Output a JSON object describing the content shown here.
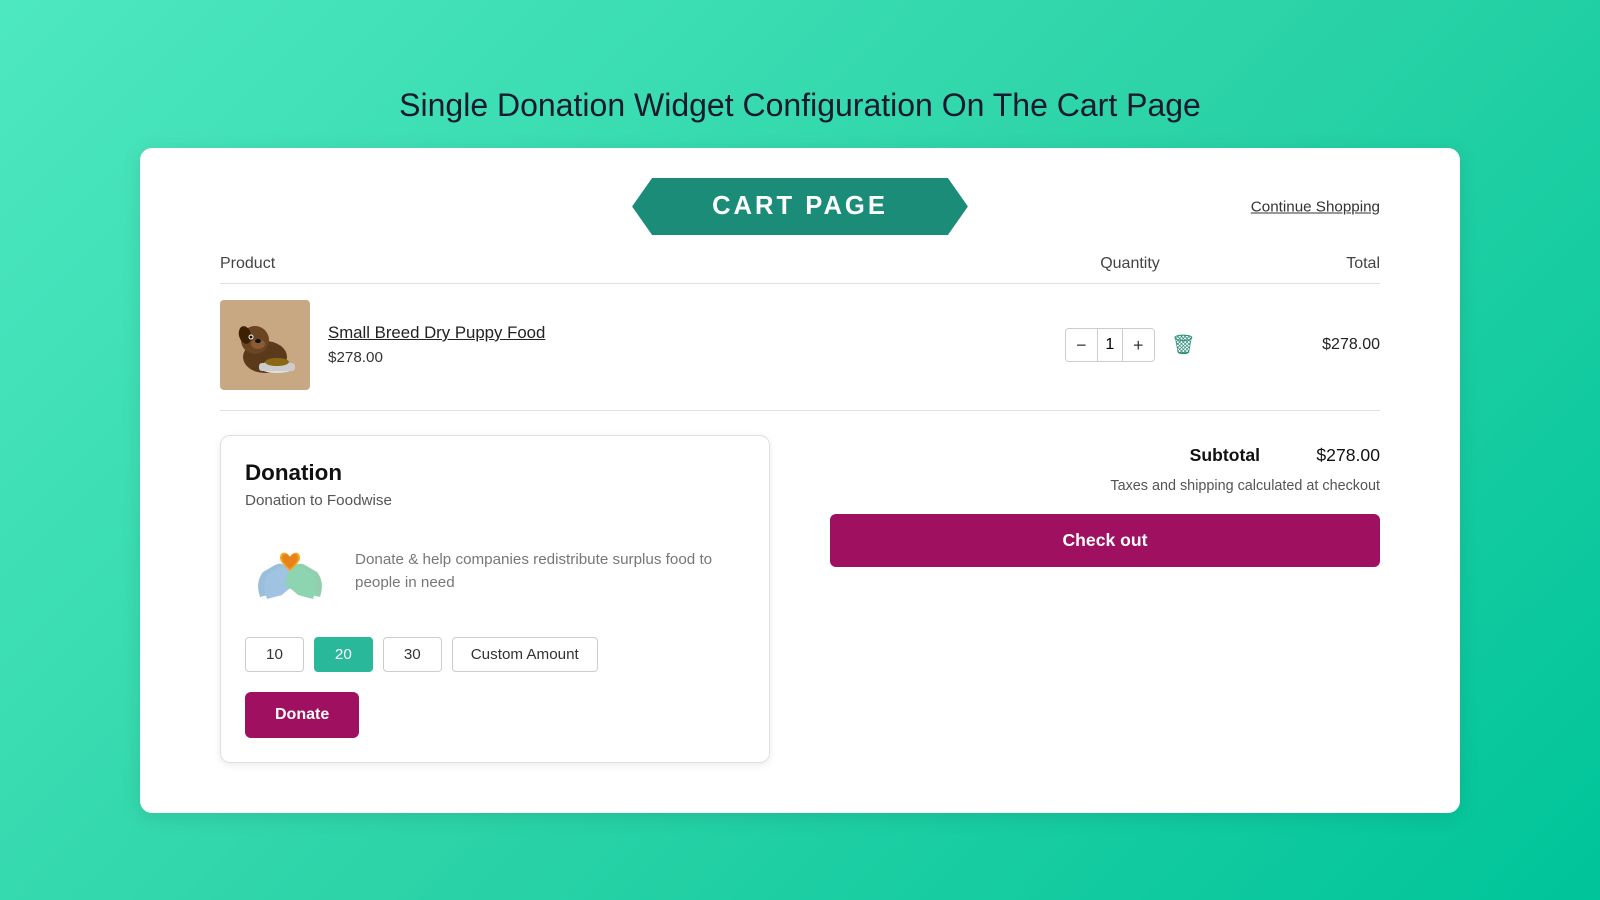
{
  "page": {
    "title": "Single Donation Widget Configuration On The Cart Page"
  },
  "header": {
    "cart_label": "CART PAGE",
    "continue_shopping": "Continue Shopping"
  },
  "table": {
    "col_product": "Product",
    "col_quantity": "Quantity",
    "col_total": "Total"
  },
  "product": {
    "name": "Small Breed Dry Puppy Food",
    "price": "$278.00",
    "quantity": 1,
    "total": "$278.00"
  },
  "donation": {
    "title": "Donation",
    "subtitle": "Donation to Foodwise",
    "description": "Donate & help companies redistribute surplus food to people in need",
    "amounts": [
      "10",
      "20",
      "30"
    ],
    "active_amount": "20",
    "custom_label": "Custom Amount",
    "donate_btn": "Donate"
  },
  "summary": {
    "subtotal_label": "Subtotal",
    "subtotal_value": "$278.00",
    "tax_note": "Taxes and shipping calculated at checkout",
    "checkout_btn": "Check out"
  },
  "icons": {
    "minus": "−",
    "plus": "+",
    "trash": "🗑"
  }
}
